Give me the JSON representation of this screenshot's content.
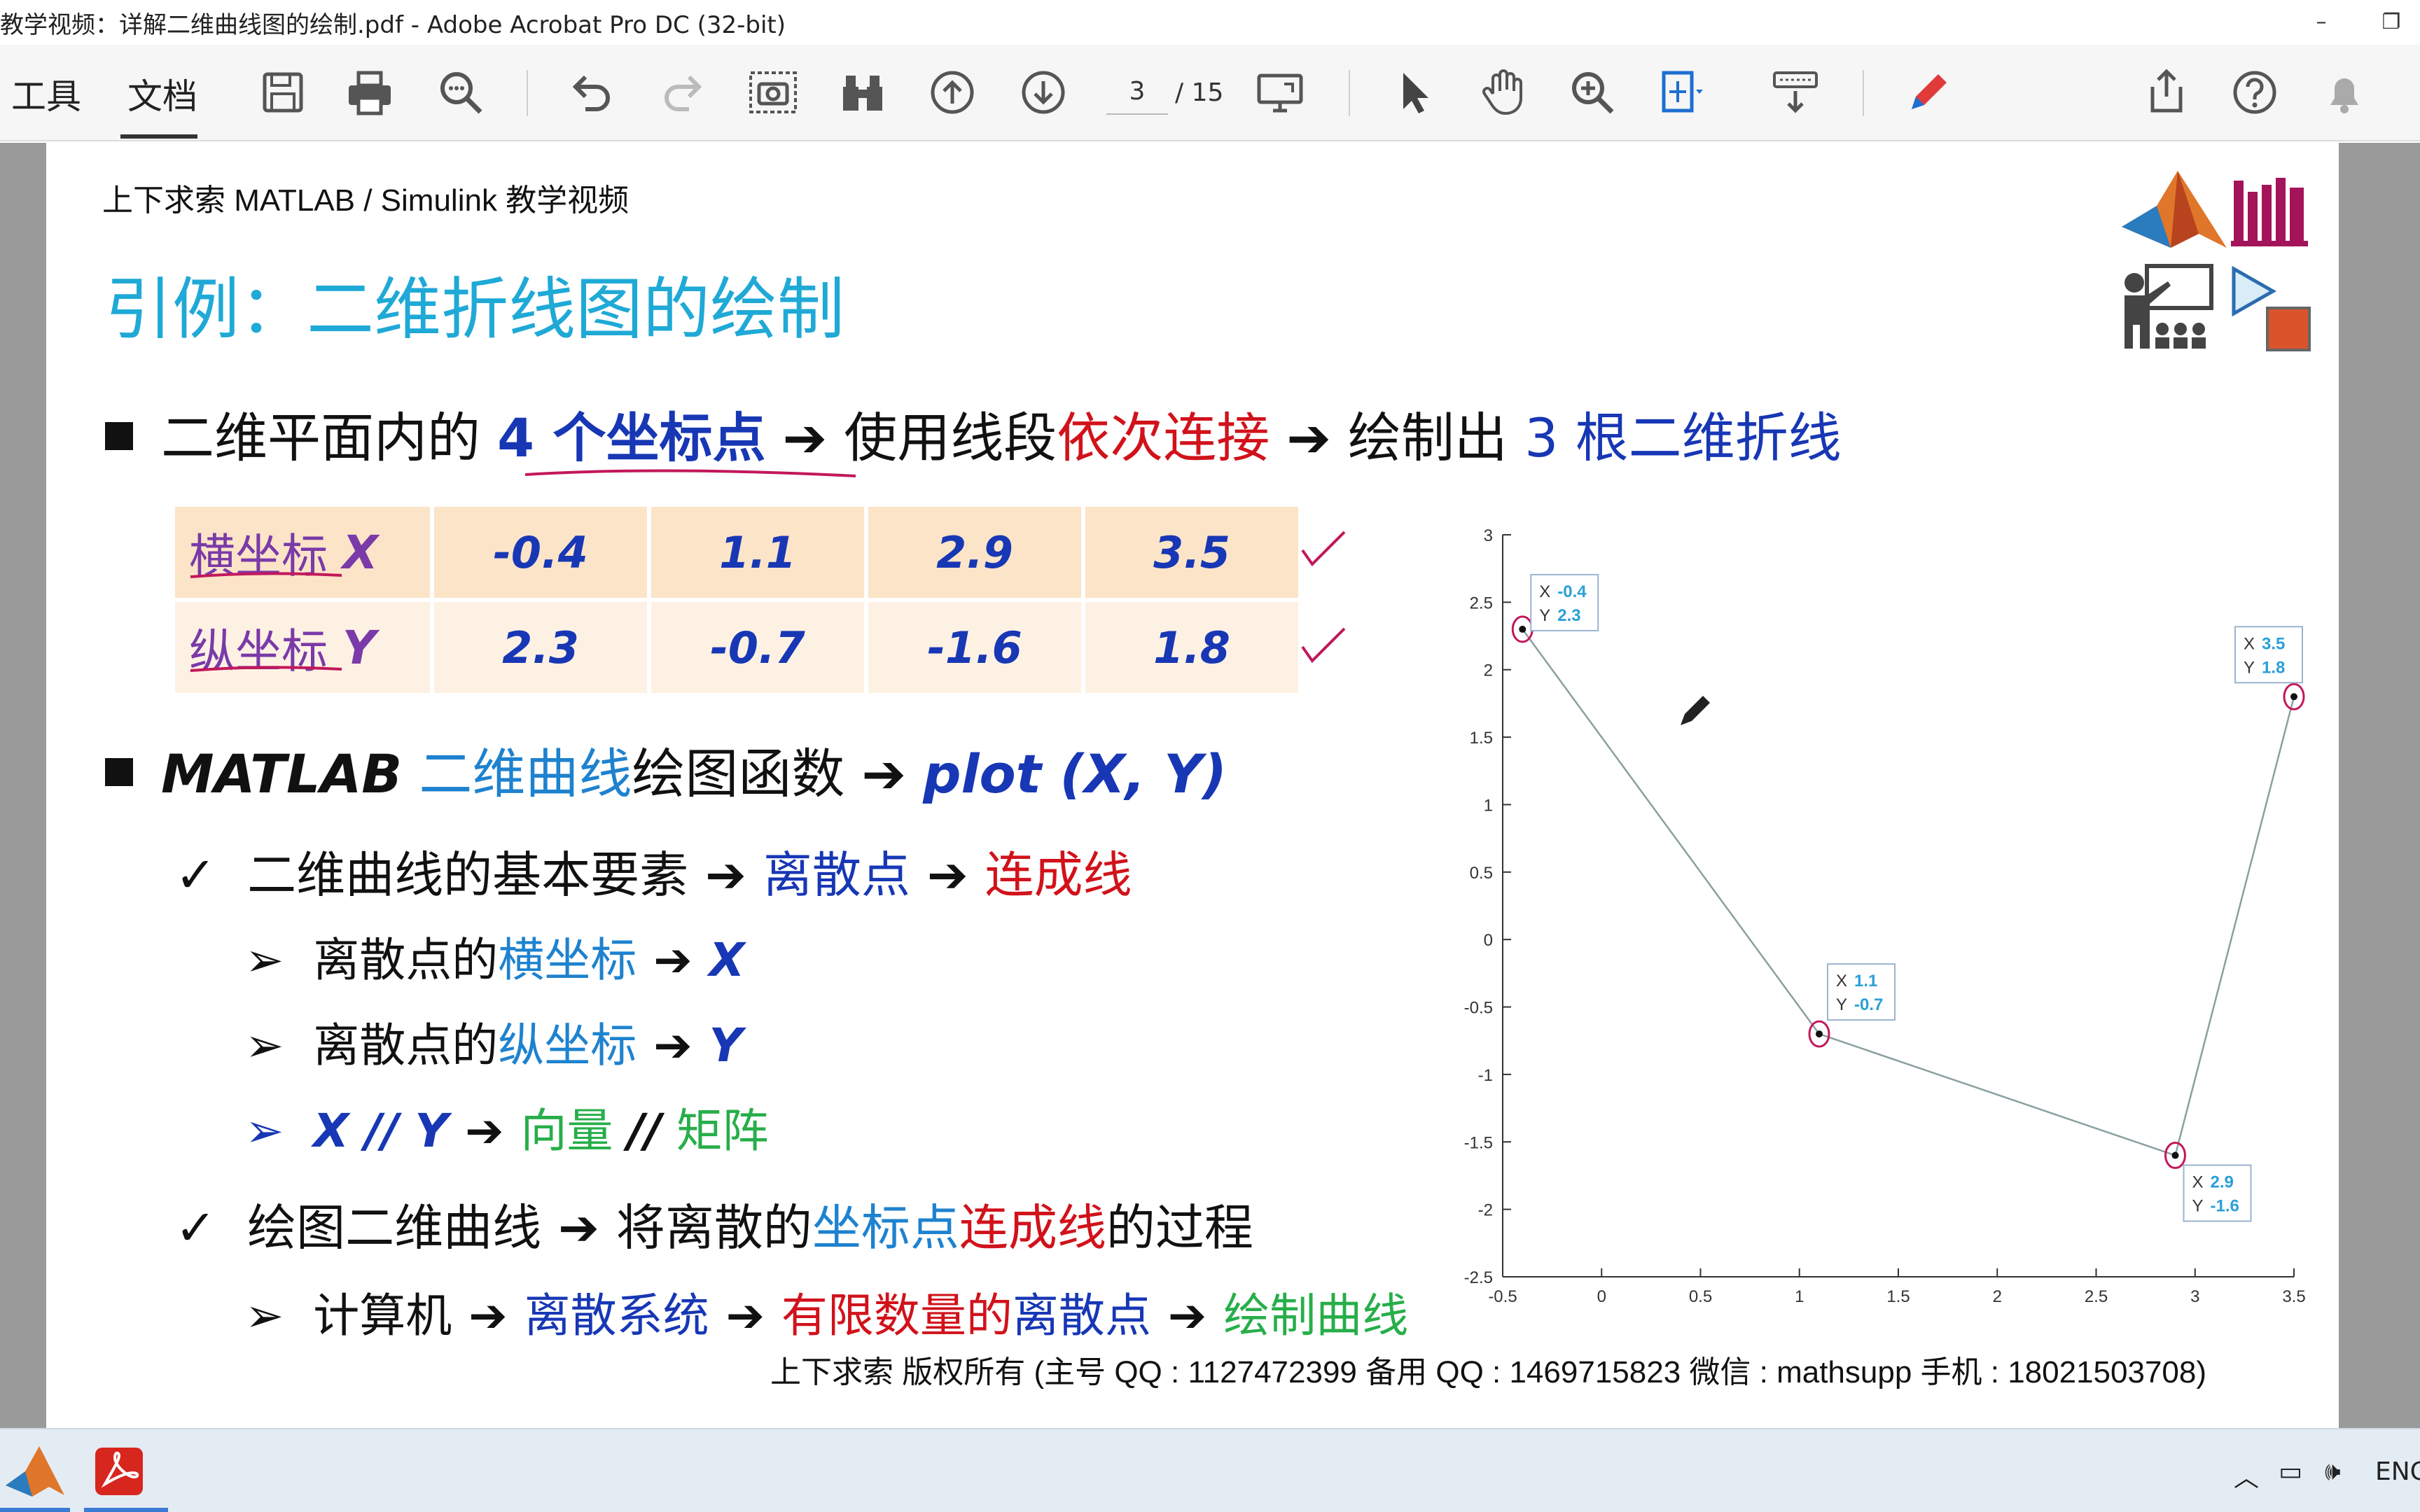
{
  "window": {
    "title": "教学视频：详解二维曲线图的绘制.pdf - Adobe Acrobat Pro DC (32-bit)",
    "minimize": "–",
    "restore": "❐"
  },
  "toolbar": {
    "tab_tools": "工具",
    "tab_document": "文档",
    "current_page": "3",
    "total_pages": "/ 15"
  },
  "slide": {
    "header": "上下求索 MATLAB / Simulink 教学视频",
    "title": "引例：二维折线图的绘制",
    "line1": {
      "p1": "二维平面内的",
      "p2": "4 个坐标点",
      "p3": "使用线段",
      "p4": "依次连接",
      "p5": "绘制出",
      "p6": "3 根二维折线"
    },
    "table": {
      "row_x_label": "横坐标",
      "row_x_var": "X",
      "row_y_label": "纵坐标",
      "row_y_var": "Y",
      "x_values": [
        "-0.4",
        "1.1",
        "2.9",
        "3.5"
      ],
      "y_values": [
        "2.3",
        "-0.7",
        "-1.6",
        "1.8"
      ]
    },
    "line2": {
      "p1": "MATLAB",
      "p2": "二维曲线",
      "p3": "绘图函数",
      "p4": "plot (X, Y)"
    },
    "sub1": {
      "check": "✓",
      "p1": "二维曲线的基本要素",
      "p2": "离散点",
      "p3": "连成线"
    },
    "sub1a": {
      "p1": "离散点的",
      "p2": "横坐标",
      "p3": "X"
    },
    "sub1b": {
      "p1": "离散点的",
      "p2": "纵坐标",
      "p3": "Y"
    },
    "sub1c": {
      "p1": "X // Y",
      "p2": "向量",
      "p3": "//",
      "p4": "矩阵"
    },
    "sub2": {
      "check": "✓",
      "p1": "绘图二维曲线",
      "p2": "将离散的",
      "p3": "坐标点",
      "p4": "连成线",
      "p5": "的过程"
    },
    "sub2a": {
      "p1": "计算机",
      "p2": "离散系统",
      "p3": "有限数量的",
      "p4": "离散点",
      "p5": "绘制曲线"
    },
    "footer": "上下求索  版权所有 (主号 QQ : 1127472399   备用 QQ : 1469715823   微信 : mathsupp   手机 : 18021503708)"
  },
  "chart_data": {
    "type": "line",
    "x": [
      -0.4,
      1.1,
      2.9,
      3.5
    ],
    "y": [
      2.3,
      -0.7,
      -1.6,
      1.8
    ],
    "xlim": [
      -0.5,
      3.5
    ],
    "ylim": [
      -2.5,
      3
    ],
    "xticks": [
      "-0.5",
      "0",
      "0.5",
      "1",
      "1.5",
      "2",
      "2.5",
      "3",
      "3.5"
    ],
    "yticks": [
      "3",
      "2.5",
      "2",
      "1.5",
      "1",
      "0.5",
      "0",
      "-0.5",
      "-1",
      "-1.5",
      "-2",
      "-2.5"
    ],
    "datatips": [
      {
        "x": "-0.4",
        "y": "2.3"
      },
      {
        "x": "1.1",
        "y": "-0.7"
      },
      {
        "x": "2.9",
        "y": "-1.6"
      },
      {
        "x": "3.5",
        "y": "1.8"
      }
    ],
    "line_color": "#8aa0a0",
    "tip_color": "#2aa0d8"
  },
  "taskbar": {
    "lang": "ENG"
  }
}
